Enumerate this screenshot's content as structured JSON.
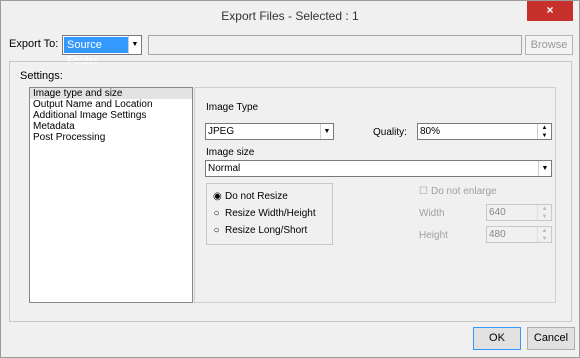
{
  "window": {
    "title": "Export Files  - Selected : 1",
    "close_glyph": "×"
  },
  "export": {
    "label": "Export To:",
    "destination": "Source Folder",
    "path_value": "",
    "browse_label": "Browse"
  },
  "settings": {
    "label": "Settings:"
  },
  "nav": {
    "items": [
      {
        "label": "Image type and size",
        "selected": true
      },
      {
        "label": "Output Name and Location",
        "selected": false
      },
      {
        "label": "Additional Image Settings",
        "selected": false
      },
      {
        "label": "Metadata",
        "selected": false
      },
      {
        "label": "Post Processing",
        "selected": false
      }
    ]
  },
  "image_type": {
    "label": "Image Type",
    "value": "JPEG",
    "quality_label": "Quality:",
    "quality_value": "80%"
  },
  "image_size": {
    "label": "Image size",
    "value": "Normal"
  },
  "resize": {
    "options": [
      "Do not Resize",
      "Resize Width/Height",
      "Resize Long/Short"
    ],
    "selected_index": 0
  },
  "enlarge": {
    "label": "Do not enlarge",
    "checked": false
  },
  "dimensions": {
    "width_label": "Width",
    "width_value": "640",
    "height_label": "Height",
    "height_value": "480"
  },
  "buttons": {
    "ok": "OK",
    "cancel": "Cancel"
  },
  "colors": {
    "accent": "#3399ff",
    "close": "#c7302b"
  }
}
